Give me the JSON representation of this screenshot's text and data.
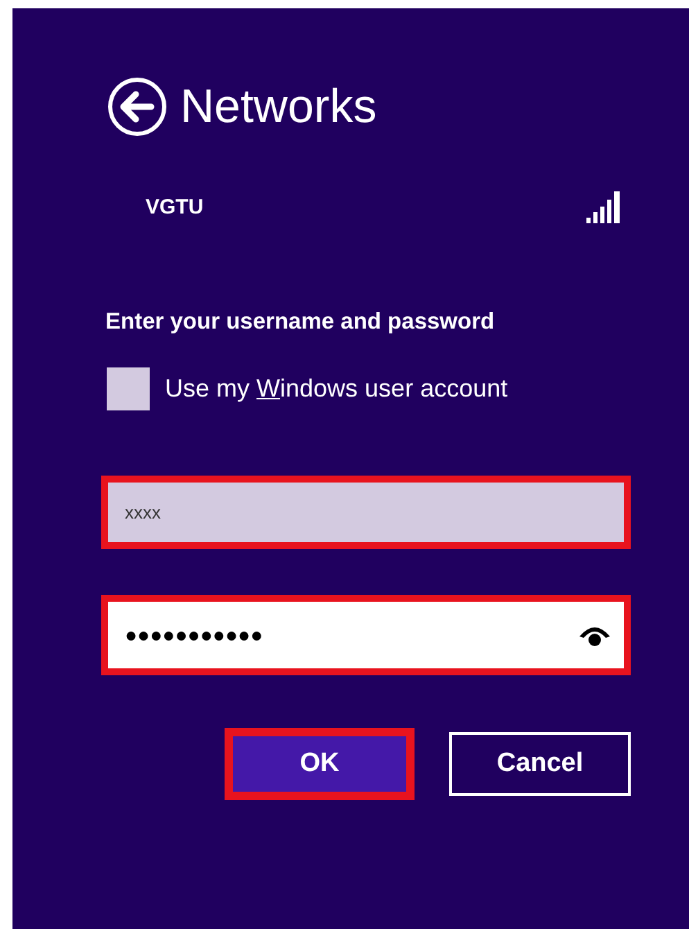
{
  "header": {
    "title": "Networks"
  },
  "network": {
    "name": "VGTU"
  },
  "prompt": "Enter your username and password",
  "windows_account": {
    "label_before": "Use my ",
    "access_key": "W",
    "label_after": "indows user account",
    "checked": false
  },
  "fields": [
    {
      "kind": "username",
      "value": "xxxx",
      "highlighted": true
    },
    {
      "kind": "password",
      "value": "●●●●●●●●●●●",
      "highlighted": true
    }
  ],
  "buttons": [
    {
      "label": "OK",
      "kind": "primary",
      "highlighted": true
    },
    {
      "label": "Cancel",
      "kind": "secondary",
      "highlighted": false
    }
  ]
}
